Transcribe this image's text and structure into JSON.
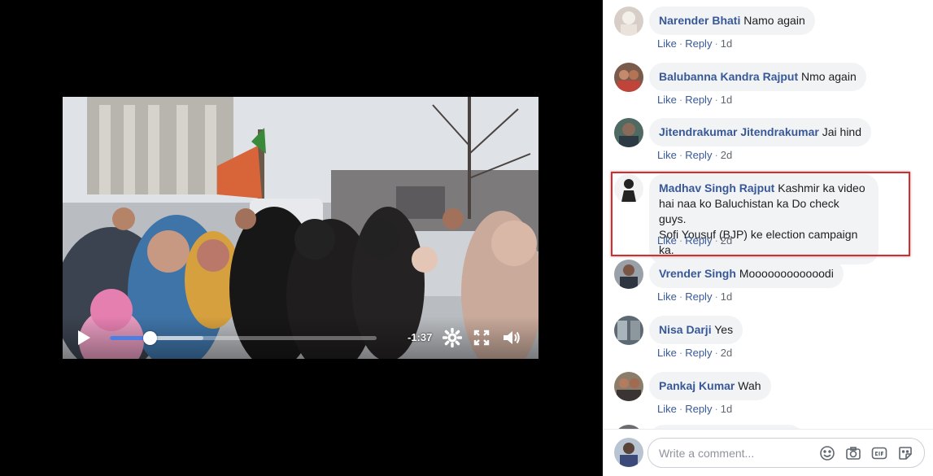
{
  "video": {
    "time_remaining": "-1:37",
    "progress": 0.15,
    "buffered": 0.35
  },
  "comments": [
    {
      "name": "Narender Bhati",
      "text": "Namo again",
      "like": "Like",
      "reply": "Reply",
      "age": "1d"
    },
    {
      "name": "Balubanna Kandra Rajput",
      "text": "Nmo again",
      "like": "Like",
      "reply": "Reply",
      "age": "1d"
    },
    {
      "name": "Jitendrakumar Jitendrakumar",
      "text": "Jai hind",
      "like": "Like",
      "reply": "Reply",
      "age": "2d"
    },
    {
      "name": "Madhav Singh Rajput",
      "text_line1": "Kashmir ka video",
      "text_line2": "hai naa ko Baluchistan ka Do check guys.",
      "text_line3": "Sofi Yousuf (BJP) ke election campaign ka.",
      "like": "Like",
      "reply": "Reply",
      "age": "2d"
    },
    {
      "name": "Vrender Singh",
      "text": "Moooooooooooodi",
      "like": "Like",
      "reply": "Reply",
      "age": "1d"
    },
    {
      "name": "Nisa Darji",
      "text": "Yes",
      "like": "Like",
      "reply": "Reply",
      "age": "2d"
    },
    {
      "name": "Pankaj Kumar",
      "text": "Wah",
      "like": "Like",
      "reply": "Reply",
      "age": "1d"
    }
  ],
  "composer": {
    "placeholder": "Write a comment...",
    "icons": [
      "emoji-icon",
      "camera-icon",
      "gif-icon",
      "sticker-icon"
    ]
  },
  "colors": {
    "name_link": "#385898",
    "highlight_border": "#d82c2c",
    "progress_fill": "#4f7de0",
    "bubble_bg": "#f2f3f5"
  }
}
